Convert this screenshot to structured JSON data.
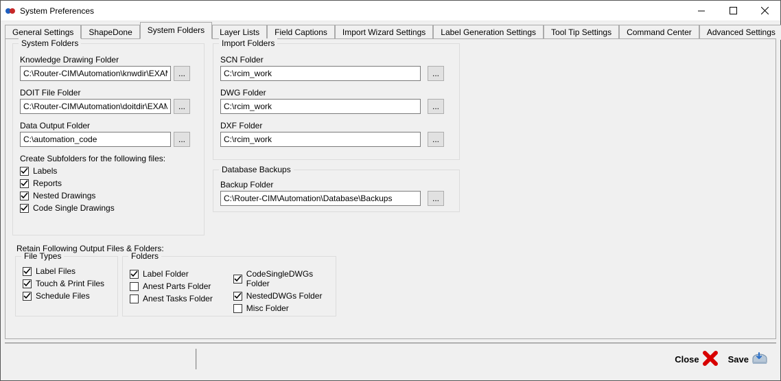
{
  "window": {
    "title": "System Preferences"
  },
  "tabs": {
    "items": [
      "General Settings",
      "ShapeDone",
      "System Folders",
      "Layer Lists",
      "Field Captions",
      "Import Wizard Settings",
      "Label Generation Settings",
      "Tool Tip Settings",
      "Command Center",
      "Advanced Settings"
    ],
    "active_index": 2
  },
  "system_folders": {
    "legend": "System Folders",
    "knowledge_label": "Knowledge Drawing Folder",
    "knowledge_value": "C:\\Router-CIM\\Automation\\knwdir\\EXAMPLES",
    "doit_label": "DOIT File Folder",
    "doit_value": "C:\\Router-CIM\\Automation\\doitdir\\EXAMPLES",
    "data_output_label": "Data Output Folder",
    "data_output_value": "C:\\automation_code",
    "subfolders_label": "Create Subfolders for the following files:",
    "sub_labels": "Labels",
    "sub_reports": "Reports",
    "sub_nested": "Nested Drawings",
    "sub_code_single": "Code Single Drawings",
    "browse": "..."
  },
  "import_folders": {
    "legend": "Import Folders",
    "scn_label": "SCN Folder",
    "scn_value": "C:\\rcim_work",
    "dwg_label": "DWG Folder",
    "dwg_value": "C:\\rcim_work",
    "dxf_label": "DXF Folder",
    "dxf_value": "C:\\rcim_work",
    "browse": "..."
  },
  "database_backups": {
    "legend": "Database Backups",
    "backup_label": "Backup Folder",
    "backup_value": "C:\\Router-CIM\\Automation\\Database\\Backups",
    "browse": "..."
  },
  "retain": {
    "heading": "Retain Following Output Files & Folders:",
    "file_types": {
      "legend": "File Types",
      "label_files": "Label Files",
      "touch_print": "Touch & Print Files",
      "schedule": "Schedule Files"
    },
    "folders": {
      "legend": "Folders",
      "label_folder": "Label Folder",
      "anest_parts": "Anest Parts Folder",
      "anest_tasks": "Anest Tasks Folder",
      "codesingle": "CodeSingleDWGs Folder",
      "nesteddwgs": "NestedDWGs Folder",
      "misc": "Misc Folder"
    }
  },
  "bottom": {
    "close": "Close",
    "save": "Save"
  },
  "checks": {
    "sub_labels": true,
    "sub_reports": true,
    "sub_nested": true,
    "sub_code_single": true,
    "ft_label": true,
    "ft_touch": true,
    "ft_schedule": true,
    "fld_label": true,
    "fld_anest_parts": false,
    "fld_anest_tasks": false,
    "fld_codesingle": true,
    "fld_nesteddwgs": true,
    "fld_misc": false
  }
}
